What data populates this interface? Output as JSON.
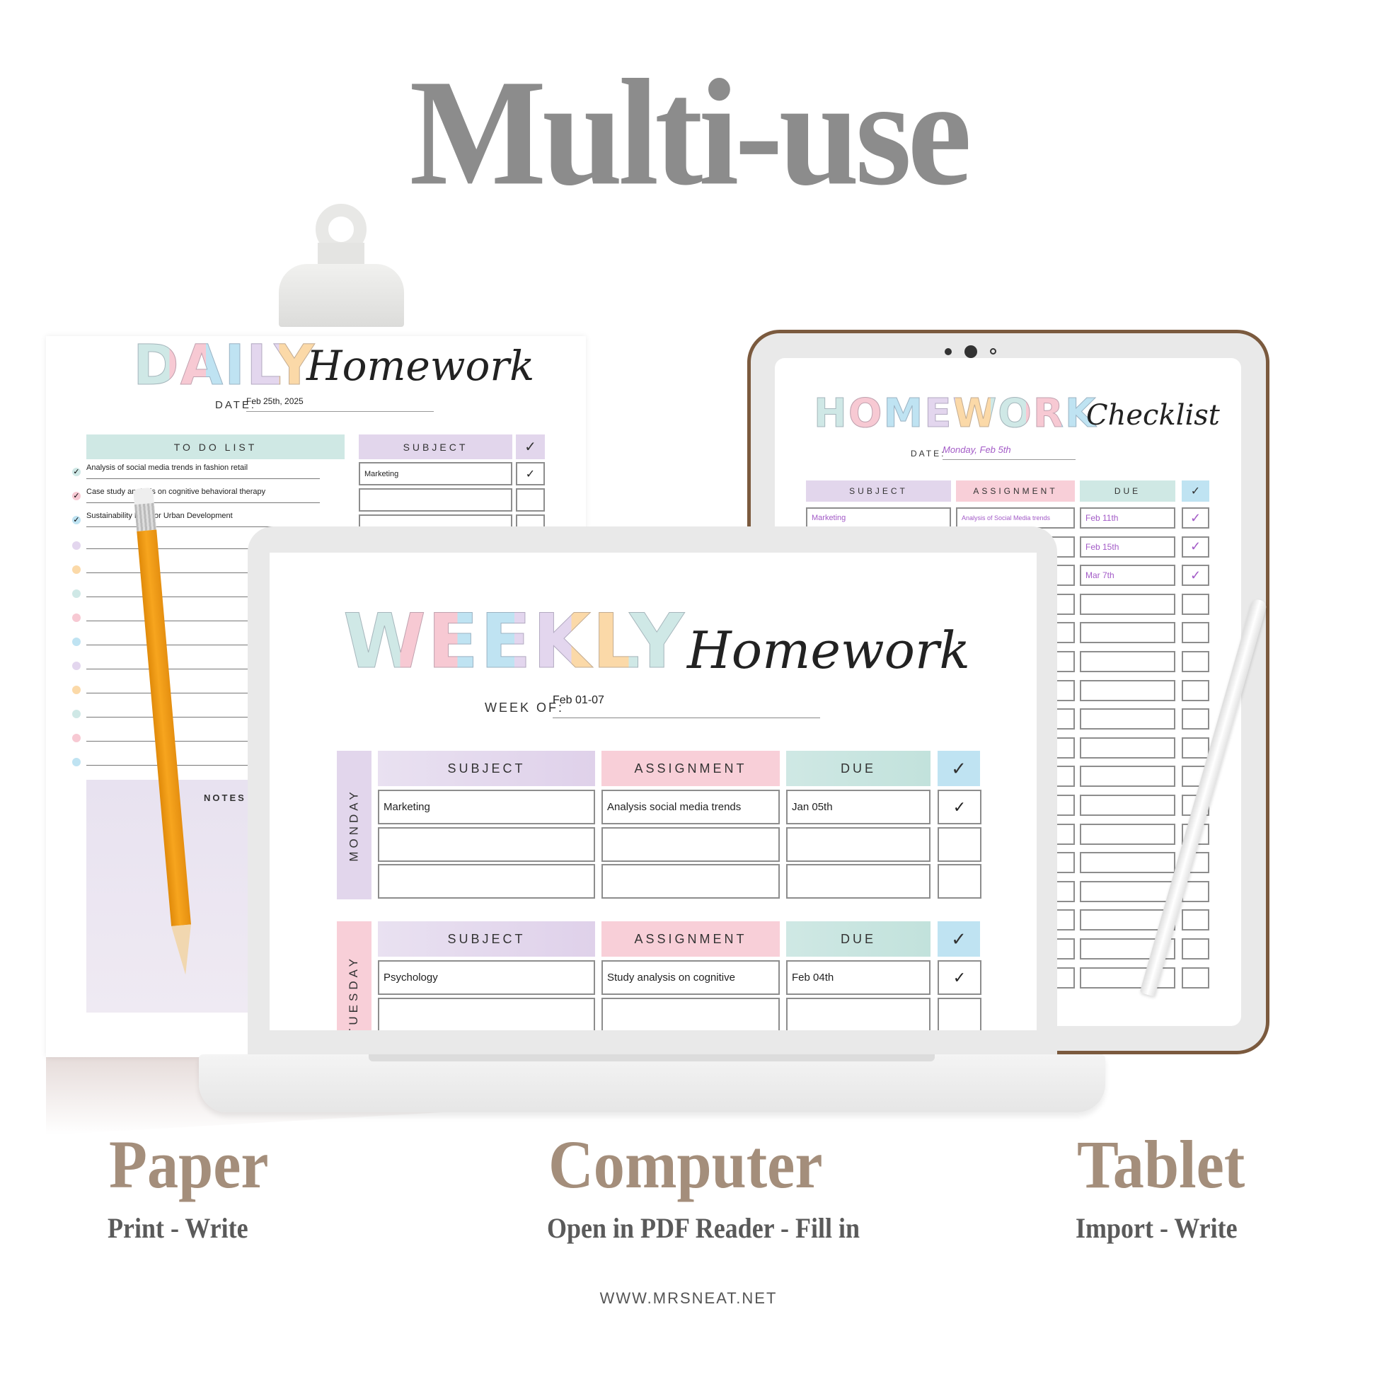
{
  "title": "Multi-use",
  "colors": {
    "title": "#8c8c8c",
    "section": "#a48e7b",
    "tablet_frame": "#7b5a3e",
    "handwriting": "#a35bc7",
    "pastel": [
      "#cfe8e6",
      "#f7c9d3",
      "#bfe3f2",
      "#e3d6ee",
      "#fbd9a8"
    ]
  },
  "daily": {
    "title_word": "DAILY",
    "title_script": "Homework",
    "date_label": "DATE:",
    "date_value": "Feb 25th, 2025",
    "todo_header": "TO DO LIST",
    "todos": [
      "Analysis of social media trends in fashion retail",
      "Case study analysis on cognitive behavioral therapy",
      "Sustainability Plan for Urban Development"
    ],
    "subject_header": "SUBJECT",
    "check_header": "✓",
    "subjects": [
      {
        "name": "Marketing",
        "check": "✓"
      },
      {
        "name": "",
        "check": ""
      }
    ],
    "notes_label": "NOTES"
  },
  "tablet": {
    "title_word": "HOMEWORK",
    "title_script": "Checklist",
    "date_label": "DATE:",
    "date_value": "Monday, Feb 5th",
    "headers": {
      "subject": "SUBJECT",
      "assignment": "ASSIGNMENT",
      "due": "DUE",
      "check": "✓"
    },
    "rows": [
      {
        "subject": "Marketing",
        "assignment": "Analysis of Social Media trends",
        "due": "Feb 11th",
        "check": "✓"
      },
      {
        "subject": "",
        "assignment": "",
        "due": "Feb 15th",
        "check": "✓"
      },
      {
        "subject": "",
        "assignment": "",
        "due": "Mar 7th",
        "check": "✓"
      }
    ]
  },
  "weekly": {
    "title_word": "WEEKLY",
    "title_script": "Homework",
    "week_label": "WEEK OF:",
    "week_value": "Feb 01-07",
    "headers": {
      "subject": "SUBJECT",
      "assignment": "ASSIGNMENT",
      "due": "DUE",
      "check": "✓"
    },
    "days": [
      {
        "day": "MONDAY",
        "rows": [
          {
            "subject": "Marketing",
            "assignment": "Analysis social media trends",
            "due": "Jan 05th",
            "check": "✓"
          },
          {
            "subject": "",
            "assignment": "",
            "due": "",
            "check": ""
          },
          {
            "subject": "",
            "assignment": "",
            "due": "",
            "check": ""
          }
        ]
      },
      {
        "day": "TUESDAY",
        "rows": [
          {
            "subject": "Psychology",
            "assignment": "Study analysis on cognitive",
            "due": "Feb 04th",
            "check": "✓"
          },
          {
            "subject": "",
            "assignment": "",
            "due": "",
            "check": ""
          }
        ]
      }
    ]
  },
  "sections": [
    {
      "title": "Paper",
      "subtitle": "Print - Write"
    },
    {
      "title": "Computer",
      "subtitle": "Open in PDF Reader - Fill in"
    },
    {
      "title": "Tablet",
      "subtitle": "Import - Write"
    }
  ],
  "website": "WWW.MRSNEAT.NET"
}
